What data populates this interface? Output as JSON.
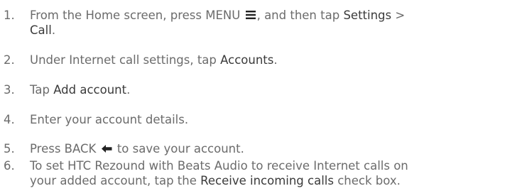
{
  "steps": [
    {
      "number": "1.",
      "line1_a": "From the Home screen, press MENU",
      "menu_icon": "menu-icon",
      "line1_b": ", and then tap",
      "settings": "Settings",
      "gt": ">",
      "call": "Call",
      "period": "."
    },
    {
      "number": "2.",
      "text_a": "Under Internet call settings, tap",
      "accounts": "Accounts",
      "period": "."
    },
    {
      "number": "3.",
      "text_a": "Tap",
      "add_account": "Add account",
      "period": "."
    },
    {
      "number": "4.",
      "text_a": "Enter your account details."
    },
    {
      "number": "5.",
      "text_a": "Press BACK",
      "back_icon": "back-arrow-icon",
      "text_b": "to save your account."
    },
    {
      "number": "6.",
      "line1": "To set HTC Rezound with Beats Audio to receive Internet calls on",
      "line2_a": "your added account, tap the",
      "receive": "Receive incoming calls",
      "line2_b": "check box."
    }
  ]
}
